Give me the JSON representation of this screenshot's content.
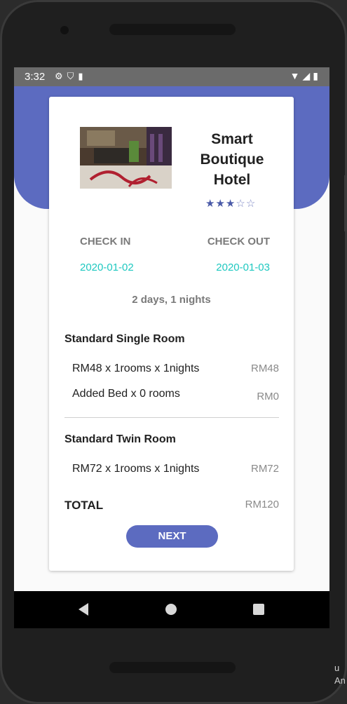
{
  "status_bar": {
    "time": "3:32",
    "left_icons": [
      "gear-icon",
      "shield-icon",
      "sd-card-icon"
    ],
    "right_icons": [
      "wifi-icon",
      "signal-icon",
      "battery-icon"
    ]
  },
  "hotel": {
    "name": "Smart Boutique Hotel",
    "rating": 3,
    "rating_max": 5
  },
  "stay": {
    "check_in_label": "CHECK IN",
    "check_out_label": "CHECK OUT",
    "check_in_date": "2020-01-02",
    "check_out_date": "2020-01-03",
    "duration": "2 days, 1 nights"
  },
  "rooms": [
    {
      "title": "Standard Single Room",
      "items": [
        {
          "label": "RM48 x 1rooms x 1nights",
          "price": "RM48"
        },
        {
          "label": "Added Bed x 0 rooms",
          "price": "RM0"
        }
      ]
    },
    {
      "title": "Standard Twin Room",
      "items": [
        {
          "label": "RM72 x 1rooms x 1nights",
          "price": "RM72"
        }
      ]
    }
  ],
  "total": {
    "label": "TOTAL",
    "value": "RM120"
  },
  "next_button": {
    "label": "NEXT"
  },
  "colors": {
    "primary": "#5c6bc0",
    "accent_date": "#1ec8c0",
    "status_bar": "#6b6b6b"
  },
  "edge_clipped_text": "u\nAn"
}
